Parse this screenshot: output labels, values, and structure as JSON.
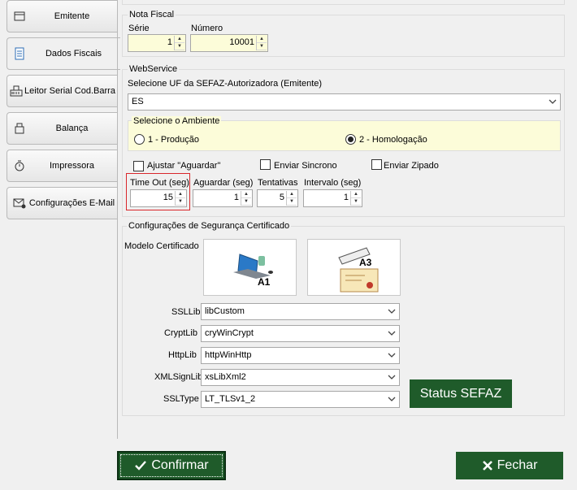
{
  "sidebar": {
    "tabs": [
      {
        "label": "Emitente",
        "icon": "card-icon"
      },
      {
        "label": "Dados Fiscais",
        "icon": "scale-icon",
        "active": true
      },
      {
        "label": "Leitor Serial Cod.Barra",
        "icon": "barcode-reader-icon"
      },
      {
        "label": "Balança",
        "icon": "balance-icon"
      },
      {
        "label": "Impressora",
        "icon": "printer-icon"
      },
      {
        "label": "Configurações E-Mail",
        "icon": "email-settings-icon"
      }
    ]
  },
  "nota_fiscal": {
    "title": "Nota Fiscal",
    "serie_label": "Série",
    "serie_value": "1",
    "numero_label": "Número",
    "numero_value": "10001"
  },
  "webservice": {
    "title": "WebService",
    "uf_label": "Selecione UF da SEFAZ-Autorizadora (Emitente)",
    "uf_value": "ES",
    "ambiente_title": "Selecione o Ambiente",
    "ambiente_opt1": "1 - Produção",
    "ambiente_opt2": "2 - Homologação",
    "ambiente_selected": "2 - Homologação",
    "ajustar_label": "Ajustar \"Aguardar\"",
    "sincrono_label": "Enviar Sincrono",
    "zipado_label": "Enviar Zipado",
    "timeout_label": "Time Out (seg)",
    "timeout_value": "15",
    "aguardar_label": "Aguardar (seg)",
    "aguardar_value": "1",
    "tentativas_label": "Tentativas",
    "tentativas_value": "5",
    "intervalo_label": "Intervalo (seg)",
    "intervalo_value": "1"
  },
  "seguranca": {
    "title": "Configurações de Segurança Certificado",
    "modelo_label": "Modelo Certificado",
    "a1_label": "A1",
    "a3_label": "A3",
    "ssllib_label": "SSLLib",
    "ssllib_value": "libCustom",
    "cryptlib_label": "CryptLib",
    "cryptlib_value": "cryWinCrypt",
    "httplib_label": "HttpLib",
    "httplib_value": "httpWinHttp",
    "xmlsignlib_label": "XMLSignLib",
    "xmlsignlib_value": "xsLibXml2",
    "ssltype_label": "SSLType",
    "ssltype_value": "LT_TLSv1_2",
    "status_button": "Status SEFAZ"
  },
  "footer": {
    "confirm_label": "Confirmar",
    "close_label": "Fechar"
  },
  "colors": {
    "green_button": "#1f5b2a",
    "yellow_input": "#fcfcd9",
    "highlight_border": "#d9262b"
  }
}
